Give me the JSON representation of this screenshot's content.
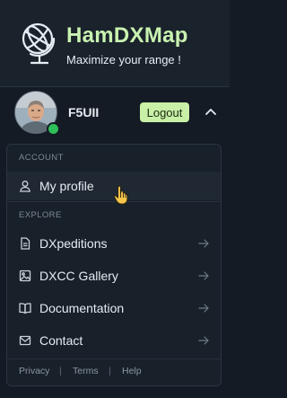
{
  "header": {
    "title": "HamDXMap",
    "tagline": "Maximize your range !",
    "logo_icon": "globe-icon"
  },
  "user": {
    "callsign": "F5UII",
    "logout_label": "Logout",
    "status": "online",
    "status_color": "#2fbf5a"
  },
  "menu": {
    "account_label": "ACCOUNT",
    "profile": {
      "label": "My profile",
      "icon": "user-icon"
    },
    "explore_label": "EXPLORE",
    "explore_items": [
      {
        "label": "DXpeditions",
        "icon": "document-icon"
      },
      {
        "label": "DXCC Gallery",
        "icon": "image-icon"
      },
      {
        "label": "Documentation",
        "icon": "book-icon"
      },
      {
        "label": "Contact",
        "icon": "mail-icon"
      }
    ]
  },
  "footer": {
    "links": [
      "Privacy",
      "Terms",
      "Help"
    ],
    "separator": "|"
  },
  "colors": {
    "accent": "#c8f0a6",
    "background": "#141b24",
    "panel": "#18202a"
  }
}
